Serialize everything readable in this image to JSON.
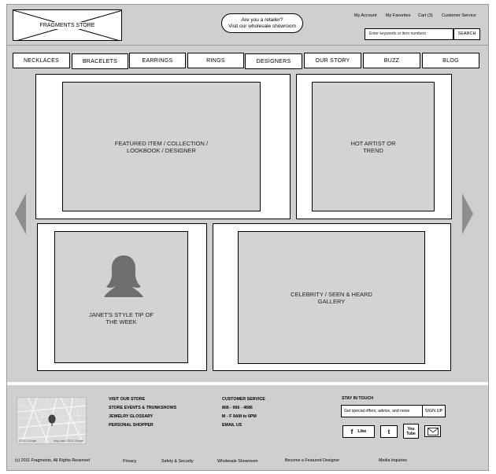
{
  "header": {
    "logo_text": "FRAGMENTS STORE",
    "retailer_line1": "Are you a retailer?",
    "retailer_line2": "Visit our wholesale showroom",
    "links": {
      "account": "My Account",
      "favorites": "My Favorites",
      "cart": "Cart (3)",
      "service": "Customer Service"
    },
    "search": {
      "placeholder": "Enter keywords or item numbers",
      "button": "SEARCH"
    }
  },
  "nav": [
    "NECKLACES",
    "BRACELETS",
    "EARRINGS",
    "RINGS",
    "DESIGNERS",
    "OUR STORY",
    "BUZZ",
    "BLOG"
  ],
  "content": {
    "featured_line1": "FEATURED ITEM / COLLECTION /",
    "featured_line2": "LOOKBOOK / DESIGNER",
    "hot_line1": "HOT ARTIST OR",
    "hot_line2": "TREND",
    "janet_line1": "JANET'S STYLE TIP OF",
    "janet_line2": "THE WEEK",
    "celebrity_line1": "CELEBRITY / SEEN & HEARD",
    "celebrity_line2": "GALLERY"
  },
  "footer": {
    "store_links": [
      "VISIT OUR STORE",
      "STORE EVENTS & TRUNKSHOWS",
      "JEWELRY GLOSSARY",
      "PERSONAL SHOPPER"
    ],
    "customer_service": {
      "heading": "CUSTOMER SERVICE",
      "phone": "866 - 966 - 4686",
      "hours": "M - F 9AM to 6PM",
      "email": "EMAIL US"
    },
    "stay_in_touch": {
      "heading": "STAY IN TOUCH",
      "placeholder": "Get special offers, advice, and news",
      "button": "SIGN UP"
    },
    "social": {
      "facebook_glyph": "f",
      "facebook_label": "Like",
      "tumblr": "t",
      "youtube_line1": "You",
      "youtube_line2": "Tube"
    },
    "map_caption": "Map data ©2011 Google",
    "map_copyright": "©2011 Google",
    "copyright": "(c) 2011 Fragments, All Rights Reserved",
    "bottom_links": [
      "Privacy",
      "Safety & Security",
      "Wholesale Showroom",
      "Become a Featured Designer",
      "Media Inquiries"
    ]
  },
  "colors": {
    "page_bg": "#cfcfcf",
    "panel_bg": "#ffffff",
    "placeholder_bg": "#d3d3d3",
    "silhouette": "#6e6e6e",
    "arrow": "#8e8e8e"
  }
}
